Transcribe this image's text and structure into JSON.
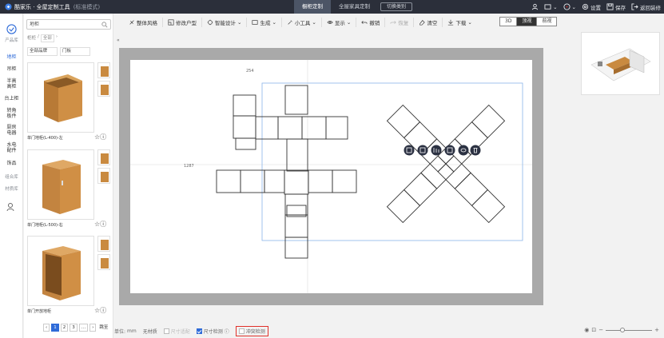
{
  "app": {
    "title": "酷家乐 · 全屋定制工具",
    "mode": "(标准模式)"
  },
  "header_tabs": [
    {
      "label": "橱柜定制",
      "active": true
    },
    {
      "label": "全屋家具定制",
      "active": false
    }
  ],
  "switch_label": "切换类别",
  "header_right": {
    "settings": "设置",
    "save": "保存",
    "back": "返回装修"
  },
  "left_rail": [
    {
      "label": "产品库",
      "active": true,
      "small": true
    },
    {
      "label": "地柜",
      "active": true
    },
    {
      "label": "吊柜",
      "active": false
    },
    {
      "label": "半高 高柜",
      "active": false
    },
    {
      "label": "台上柜",
      "active": false
    },
    {
      "label": "转角 板件",
      "active": false
    },
    {
      "label": "厨房 电器",
      "active": false
    },
    {
      "label": "水电 配件",
      "active": false
    },
    {
      "label": "饰品",
      "active": false
    },
    {
      "label": "组合库",
      "active": false,
      "small": true
    },
    {
      "label": "材质库",
      "active": false,
      "small": true
    }
  ],
  "catalog": {
    "search_value": "地柜",
    "breadcrumb": [
      "柜柜",
      "全部"
    ],
    "filter_brand": "全部品牌",
    "filter_type": "门板",
    "products": [
      {
        "name": "单门地柜(L-400)-左"
      },
      {
        "name": "单门地柜(L-500)-右"
      },
      {
        "name": "单门开放地柜"
      }
    ],
    "pager": {
      "pages": [
        "1",
        "2",
        "3"
      ],
      "current": "1",
      "jump": "跳至"
    }
  },
  "toolbar": {
    "items": [
      "整体风格",
      "修改户型",
      "智能设计",
      "生成",
      "小工具",
      "显示",
      "撤销",
      "恢复",
      "清空",
      "下载"
    ],
    "view_modes": [
      {
        "label": "3D",
        "active": false
      },
      {
        "label": "顶视",
        "active": true
      },
      {
        "label": "前视",
        "active": false
      }
    ]
  },
  "canvas": {
    "dim_top": "254",
    "dim_left": "1287"
  },
  "status": {
    "unit_label": "单位:",
    "unit_value": "mm",
    "no_material": "无材质",
    "size_fit": "尺寸适配",
    "size_check": "尺寸检测",
    "collision_check": "冲突检测"
  },
  "colors": {
    "accent": "#2f6bd8",
    "highlight": "#e0312a",
    "wood": "#c98a40"
  }
}
